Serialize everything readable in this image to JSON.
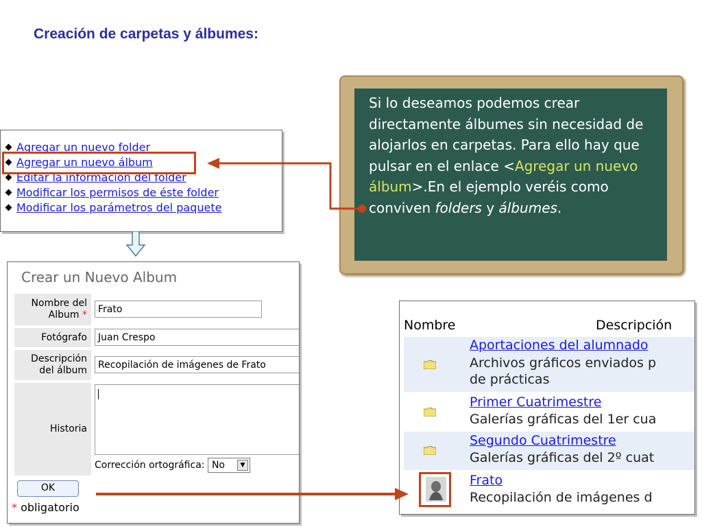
{
  "slide": {
    "title": "Creación de carpetas y álbumes:"
  },
  "folder_menu": {
    "items": [
      {
        "label": "Agregar un nuevo folder"
      },
      {
        "label": "Agregar un nuevo álbum"
      },
      {
        "label": "Editar la información del folder"
      },
      {
        "label": "Modificar los permisos de éste folder"
      },
      {
        "label": "Modificar los parámetros del paquete"
      }
    ]
  },
  "album_form": {
    "title": "Crear un Nuevo Album",
    "name_label_line1": "Nombre del",
    "name_label_line2": "Album",
    "required_mark": "*",
    "name_value": "Frato",
    "photographer_label": "Fotógrafo",
    "photographer_value": "Juan Crespo",
    "description_label_line1": "Descripción",
    "description_label_line2": "del álbum",
    "description_value": "Recopilación de imágenes de Frato",
    "history_label": "Historia",
    "history_value": "",
    "spellcheck_label": "Corrección ortográfica:",
    "spellcheck_value": "No",
    "ok_label": "OK",
    "required_note": "obligatorio"
  },
  "chalkboard": {
    "text_part1": "Si lo deseamos podemos crear directamente álbumes sin necesidad de alojarlos en carpetas. Para ello hay que pulsar en el enlace <",
    "link_text": "Agregar un nuevo álbum",
    "text_part2": ">.En el ejemplo veréis como conviven ",
    "em1": "folders",
    "text_part3": " y ",
    "em2": "álbumes",
    "text_part4": "."
  },
  "album_list": {
    "col_name": "Nombre",
    "col_description": "Descripción",
    "rows": [
      {
        "name": "Aportaciones del alumnado",
        "desc_line1": "Archivos gráficos enviados p",
        "desc_line2": "de prácticas",
        "icon": "folder-icon"
      },
      {
        "name": "Primer Cuatrimestre",
        "desc_line1": "Galerías gráficas del 1er cua",
        "icon": "folder-icon"
      },
      {
        "name": "Segundo Cuatrimestre",
        "desc_line1": "Galerías gráficas del 2º cuat",
        "icon": "folder-icon"
      },
      {
        "name": "Frato",
        "desc_line1": "Recopilación de imágenes d",
        "icon": "photo-thumbnail-icon"
      }
    ]
  },
  "colors": {
    "title": "#2b2f9a",
    "highlight": "#c0441d",
    "board": "#2d5a4f",
    "board_frame": "#c9b081",
    "link": "#1a1ae0",
    "board_link": "#d8e65a"
  }
}
